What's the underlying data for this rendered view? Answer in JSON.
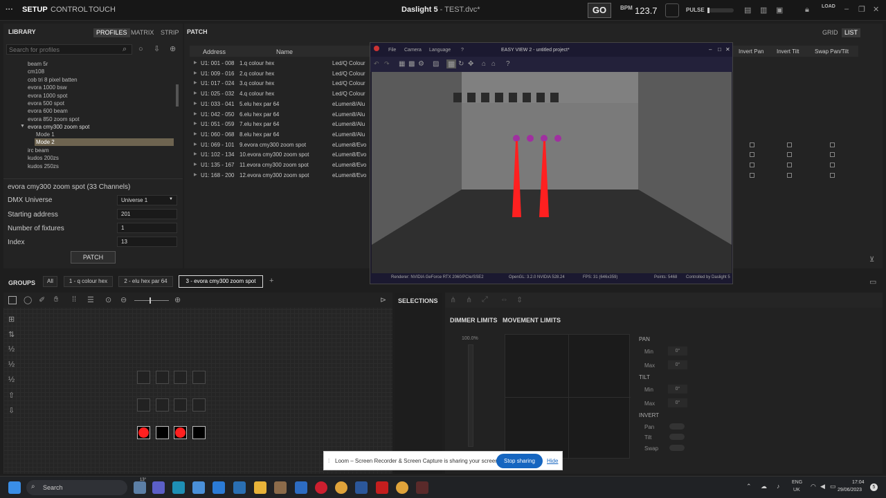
{
  "app": {
    "menu_icon": "more-icon",
    "modes": [
      "SETUP",
      "CONTROL",
      "TOUCH"
    ],
    "title": "Daslight 5",
    "file": " - TEST.dvc*",
    "go": "GO",
    "bpm_label": "BPM",
    "bpm_value": "123.7",
    "pulse": "PULSE",
    "load": "LOAD"
  },
  "library": {
    "title": "LIBRARY",
    "tabs": [
      "PROFILES",
      "MATRIX",
      "STRIP"
    ],
    "search_placeholder": "Search for profiles",
    "items": [
      "beam 5r",
      "cm108",
      "cob tri 8 pixel batten",
      "evora 1000 bsw",
      "evora 1000 spot",
      "evora 500 spot",
      "evora 600 beam",
      "evora 850 zoom spot",
      "evora cmy300 zoom spot",
      "Mode 1",
      "Mode 2",
      "irc beam",
      "kudos 200zs",
      "kudos 250zs"
    ],
    "fixture_title": "evora cmy300 zoom spot (33 Channels)",
    "fields": [
      {
        "label": "DMX Universe",
        "value": "Universe 1"
      },
      {
        "label": "Starting address",
        "value": "201"
      },
      {
        "label": "Number of fixtures",
        "value": "1"
      },
      {
        "label": "Index",
        "value": "13"
      }
    ],
    "patch_button": "PATCH"
  },
  "patch": {
    "title": "PATCH",
    "view_grid": "GRID",
    "view_list": "LIST",
    "headers": [
      "Address",
      "Name",
      "Invert Pan",
      "Invert Tilt",
      "Swap Pan/Tilt"
    ],
    "rows": [
      {
        "addr": "U1: 001 - 008",
        "name": "1.q colour hex",
        "prof": "Led/Q Colour"
      },
      {
        "addr": "U1: 009 - 016",
        "name": "2.q colour hex",
        "prof": "Led/Q Colour"
      },
      {
        "addr": "U1: 017 - 024",
        "name": "3.q colour hex",
        "prof": "Led/Q Colour"
      },
      {
        "addr": "U1: 025 - 032",
        "name": "4.q colour hex",
        "prof": "Led/Q Colour"
      },
      {
        "addr": "U1: 033 - 041",
        "name": "5.elu hex par 64",
        "prof": "eLumen8/Alu"
      },
      {
        "addr": "U1: 042 - 050",
        "name": "6.elu hex par 64",
        "prof": "eLumen8/Alu"
      },
      {
        "addr": "U1: 051 - 059",
        "name": "7.elu hex par 64",
        "prof": "eLumen8/Alu"
      },
      {
        "addr": "U1: 060 - 068",
        "name": "8.elu hex par 64",
        "prof": "eLumen8/Alu"
      },
      {
        "addr": "U1: 069 - 101",
        "name": "9.evora cmy300 zoom spot",
        "prof": "eLumen8/Evo"
      },
      {
        "addr": "U1: 102 - 134",
        "name": "10.evora cmy300 zoom spot",
        "prof": "eLumen8/Evo"
      },
      {
        "addr": "U1: 135 - 167",
        "name": "11.evora cmy300 zoom spot",
        "prof": "eLumen8/Evo"
      },
      {
        "addr": "U1: 168 - 200",
        "name": "12.evora cmy300 zoom spot",
        "prof": "eLumen8/Evo"
      }
    ]
  },
  "easyview": {
    "menus": [
      "File",
      "Camera",
      "Language",
      "?"
    ],
    "title": "EASY VIEW 2 - untitled project*",
    "status": {
      "renderer": "Renderer:  NVIDIA GeForce RTX 2060/PCIe/SSE2",
      "opengl": "OpenGL:  3.2.0 NVIDIA 528.24",
      "fps": "FPS:  31 (646x359)",
      "points": "Points:  5468",
      "controlled": "Controlled by  Daslight 5"
    }
  },
  "groups": {
    "title": "GROUPS",
    "items": [
      "All",
      "1 - q colour hex",
      "2 - elu hex par 64",
      "3 - evora cmy300 zoom spot"
    ]
  },
  "selections": {
    "title": "SELECTIONS"
  },
  "limits": {
    "dimmer_tab": "DIMMER LIMITS",
    "movement_tab": "MOVEMENT LIMITS",
    "dimmer_value": "100.0%",
    "pan": "PAN",
    "tilt": "TILT",
    "min": "Min",
    "max": "Max",
    "deg": "0°",
    "invert": "INVERT",
    "pan_l": "Pan",
    "tilt_l": "Tilt",
    "swap_l": "Swap"
  },
  "loom": {
    "text": "Loom – Screen Recorder & Screen Capture is sharing your screen.",
    "stop": "Stop sharing",
    "hide": "Hide"
  },
  "taskbar": {
    "search": "Search",
    "weather": "13°",
    "lang1": "ENG",
    "lang2": "UK",
    "time": "17:04",
    "date": "29/06/2023",
    "notif": "5"
  },
  "colors": {
    "accent": "#ff2020",
    "loom_blue": "#1565c0"
  }
}
